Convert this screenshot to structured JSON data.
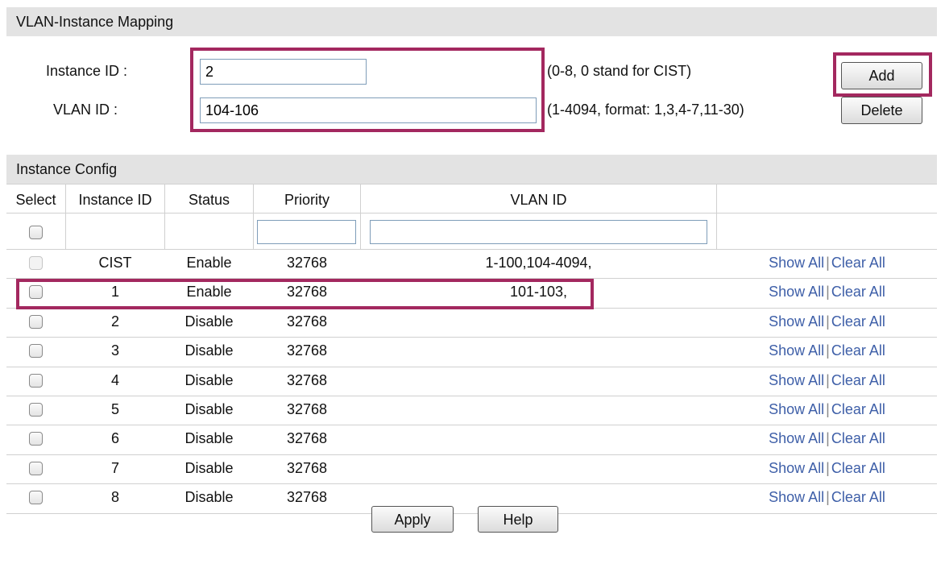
{
  "mapping": {
    "header": "VLAN-Instance Mapping",
    "instance_label": "Instance ID :",
    "instance_value": "2",
    "instance_hint": "(0-8, 0 stand for CIST)",
    "vlan_label": "VLAN ID :",
    "vlan_value": "104-106",
    "vlan_hint": "(1-4094, format: 1,3,4-7,11-30)",
    "add_label": "Add",
    "delete_label": "Delete"
  },
  "config": {
    "header": "Instance Config",
    "columns": [
      "Select",
      "Instance ID",
      "Status",
      "Priority",
      "VLAN ID"
    ],
    "filter_priority": "",
    "filter_vlan": "",
    "rows": [
      {
        "id": "CIST",
        "status": "Enable",
        "priority": "32768",
        "vlan": "1-100,104-4094,",
        "show": "Show All",
        "clear": "Clear All",
        "checkbox_disabled": true
      },
      {
        "id": "1",
        "status": "Enable",
        "priority": "32768",
        "vlan": "101-103,",
        "show": "Show All",
        "clear": "Clear All"
      },
      {
        "id": "2",
        "status": "Disable",
        "priority": "32768",
        "vlan": "",
        "show": "Show All",
        "clear": "Clear All"
      },
      {
        "id": "3",
        "status": "Disable",
        "priority": "32768",
        "vlan": "",
        "show": "Show All",
        "clear": "Clear All"
      },
      {
        "id": "4",
        "status": "Disable",
        "priority": "32768",
        "vlan": "",
        "show": "Show All",
        "clear": "Clear All"
      },
      {
        "id": "5",
        "status": "Disable",
        "priority": "32768",
        "vlan": "",
        "show": "Show All",
        "clear": "Clear All"
      },
      {
        "id": "6",
        "status": "Disable",
        "priority": "32768",
        "vlan": "",
        "show": "Show All",
        "clear": "Clear All"
      },
      {
        "id": "7",
        "status": "Disable",
        "priority": "32768",
        "vlan": "",
        "show": "Show All",
        "clear": "Clear All"
      },
      {
        "id": "8",
        "status": "Disable",
        "priority": "32768",
        "vlan": "",
        "show": "Show All",
        "clear": "Clear All"
      }
    ],
    "separator": "|"
  },
  "footer": {
    "apply_label": "Apply",
    "help_label": "Help"
  },
  "colors": {
    "highlight": "#a3285f",
    "link": "#3e5fa8",
    "header_bg": "#e3e3e3"
  }
}
